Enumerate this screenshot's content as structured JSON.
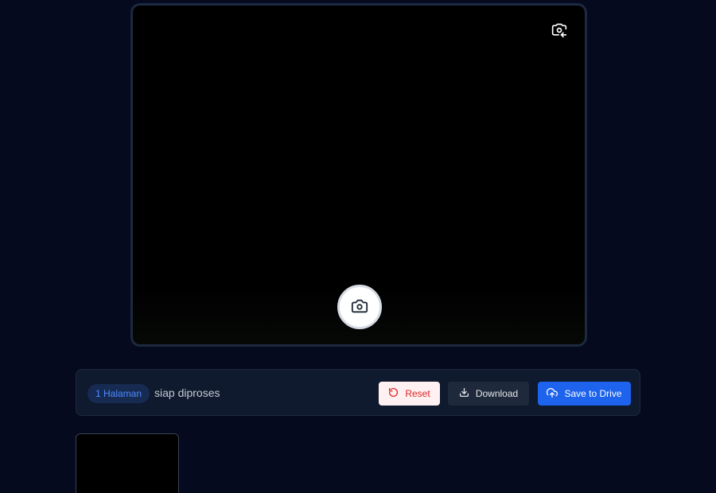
{
  "camera": {
    "switch_icon": "switch-camera-icon",
    "shutter_icon": "camera-icon"
  },
  "toolbar": {
    "page_count": "1 Halaman",
    "status": "siap diproses",
    "reset_label": "Reset",
    "download_label": "Download",
    "save_drive_label": "Save to Drive"
  },
  "colors": {
    "background": "#050a1e",
    "accent": "#1d63ed",
    "danger": "#dc2626",
    "badge_text": "#4f8cff"
  }
}
